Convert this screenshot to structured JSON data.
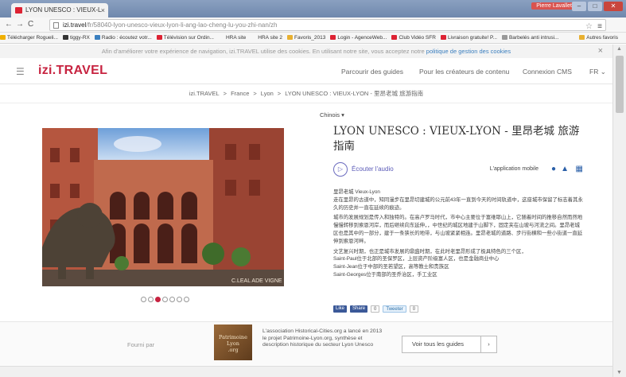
{
  "browser": {
    "tab_title": "LYON UNESCO : VIEUX-L",
    "tab_close": "×",
    "user_label": "Pierre Lavallet",
    "url_host": "izi.travel",
    "url_path": "/fr/58040-lyon-unesco-vieux-lyon-li-ang-lao-cheng-lu-you-zhi-nan/zh",
    "bookmarks": [
      {
        "label": "Télécharger Rogueli...",
        "color": "#f0b000"
      },
      {
        "label": "tiggy-RX",
        "color": "#333"
      },
      {
        "label": "Radio : écoutez votr...",
        "color": "#3b7fbf"
      },
      {
        "label": "Télévision sur Ordin...",
        "color": "#d23"
      },
      {
        "label": "HRA site",
        "color": ""
      },
      {
        "label": "HRA site 2",
        "color": ""
      },
      {
        "label": "Favoris_2013",
        "color": "#e8b030"
      },
      {
        "label": "Login - AgenceWeb...",
        "color": "#d23"
      },
      {
        "label": "Club Vidéo SFR",
        "color": "#d23"
      },
      {
        "label": "Livraison gratuite! P...",
        "color": "#d23"
      },
      {
        "label": "Barbelés anti intrusi...",
        "color": "#999"
      }
    ],
    "other_bookmarks": "Autres favoris"
  },
  "cookie": {
    "text": "Afin d'améliorer votre expérience de navigation, izi.TRAVEL utilise des cookies. En utilisant notre site, vous acceptez notre ",
    "link": "politique de gestion des cookies",
    "close": "×"
  },
  "header": {
    "logo_prefix": "izi",
    "logo_suffix": ".TRAVEL",
    "nav": [
      "Parcourir des guides",
      "Pour les créateurs de contenu",
      "Connexion CMS",
      "FR"
    ]
  },
  "breadcrumb": [
    "izi.TRAVEL",
    "France",
    "Lyon",
    "LYON UNESCO : VIEUX-LYON - 里昂老城 旅游指南"
  ],
  "breadcrumb_sep": ">",
  "guide": {
    "language": "Chinois ▾",
    "title": "LYON UNESCO : VIEUX-LYON - 里昂老城 旅游指南",
    "listen_label": "Écouter l'audio",
    "mobile_app_label": "L'application mobile",
    "photo_credit": "C.LEAL ADE VIGNE",
    "description": [
      "里昂老城 Vieux-Lyon\n走在里昂的古道中，知同漫步在里昂切建城的公元前43年一直到今天的时间轨道中，这座城市保留了标志着其永久的历史并一直在延续的痕迹。",
      "城市的发展规划是传入和独特的。在高卢罗马时代，市中心主要位于富维耶山上，它随着时间的推移自然而然地慢慢转移到索恩河岸，而后继续向东延伸，，中世纪的城区地建于山脚下，固定夹在山坡与河流之间。里昂老城区也是其中的一部分，建于一条狭长的地带，与山坡紧紧相连。里昂老城的道路、步行街横和一些小街道一直延伸到索恩河畔。",
      "文艺复兴时期，也正是城市发展的鼎盛时期，在此时老里昂形成了极具特色的三个区，\nSaint-Paul位于北部的圣保罗区，上层资产阶级富人区，也是金融商业中心\nSaint-Jean位于中部的圣若望区，高等教士和贵族区\nSaint-Georges位于南部的圣乔治区，手工业区"
    ],
    "social": {
      "like": "Like",
      "share": "Share",
      "like_count": "0",
      "tweet": "Tweeter",
      "tweet_count": "0"
    },
    "carousel_count": 7,
    "carousel_active": 2
  },
  "footer": {
    "provided_by": "Fourni par",
    "org_logo_text": "Patrimoine\nLyon\n.org",
    "org_description": "L'association Historical-Cities.org a lancé en 2013 le projet Patrimoine-Lyon.org, synthèse et description historique du secteur Lyon Unesco",
    "all_guides_button": "Voir tous les guides",
    "all_guides_arrow": "›"
  }
}
